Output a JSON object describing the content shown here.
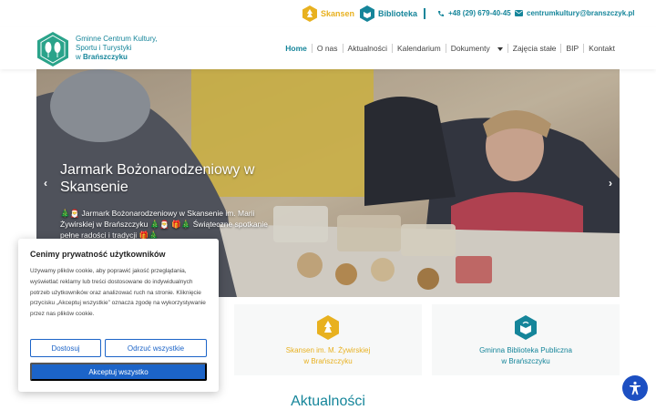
{
  "topbar": {
    "skansen_label": "Skansen",
    "biblioteka_label": "Biblioteka",
    "phone": "+48 (29) 679-40-45",
    "email": "centrumkultury@branszczyk.pl"
  },
  "header": {
    "logo_line1": "Gminne Centrum Kultury,",
    "logo_line2": "Sportu i Turystyki",
    "logo_line3_prefix": "w ",
    "logo_line3_bold": "Brańszczyku"
  },
  "nav": {
    "items": [
      "Home",
      "O nas",
      "Aktualności",
      "Kalendarium",
      "Dokumenty",
      "Zajęcia stałe",
      "BIP",
      "Kontakt"
    ]
  },
  "hero": {
    "title": "Jarmark Bożonarodzeniowy w Skansenie",
    "text": "🎄🎅 Jarmark Bożonarodzeniowy w Skansenie im. Marii Żywirskiej w Brańszczyku 🎄🎅 🎁🎄 Świąteczne spotkanie pełne radości i tradycji 🎁🎄",
    "prev": "‹",
    "next": "›"
  },
  "cards": {
    "skansen_line1": "Skansen im. M. Żywirskiej",
    "skansen_line2": "w Brańszczyku",
    "biblioteka_line1": "Gminna Biblioteka Publiczna",
    "biblioteka_line2": "w Brańszczyku"
  },
  "section_title": "Aktualności",
  "cookie": {
    "title": "Cenimy prywatność użytkowników",
    "text": "Używamy plików cookie, aby poprawić jakość przeglądania, wyświetlać reklamy lub treści dostosowane do indywidualnych potrzeb użytkowników oraz analizować ruch na stronie. Kliknięcie przycisku „Akceptuj wszystkie” oznacza zgodę na wykorzystywanie przez nas plików cookie.",
    "customize": "Dostosuj",
    "reject": "Odrzuć wszystkie",
    "accept": "Akceptuj wszystko"
  },
  "colors": {
    "teal": "#15859a",
    "gold": "#e8b120",
    "blue": "#1c64c8"
  }
}
